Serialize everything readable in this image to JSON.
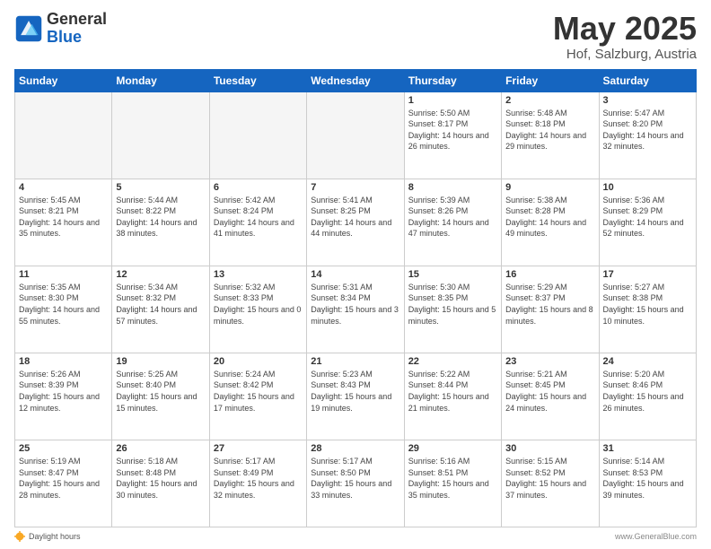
{
  "header": {
    "logo_general": "General",
    "logo_blue": "Blue",
    "title": "May 2025",
    "location": "Hof, Salzburg, Austria"
  },
  "weekdays": [
    "Sunday",
    "Monday",
    "Tuesday",
    "Wednesday",
    "Thursday",
    "Friday",
    "Saturday"
  ],
  "weeks": [
    [
      {
        "day": "",
        "empty": true
      },
      {
        "day": "",
        "empty": true
      },
      {
        "day": "",
        "empty": true
      },
      {
        "day": "",
        "empty": true
      },
      {
        "day": "1",
        "sunrise": "5:50 AM",
        "sunset": "8:17 PM",
        "daylight": "14 hours and 26 minutes."
      },
      {
        "day": "2",
        "sunrise": "5:48 AM",
        "sunset": "8:18 PM",
        "daylight": "14 hours and 29 minutes."
      },
      {
        "day": "3",
        "sunrise": "5:47 AM",
        "sunset": "8:20 PM",
        "daylight": "14 hours and 32 minutes."
      }
    ],
    [
      {
        "day": "4",
        "sunrise": "5:45 AM",
        "sunset": "8:21 PM",
        "daylight": "14 hours and 35 minutes."
      },
      {
        "day": "5",
        "sunrise": "5:44 AM",
        "sunset": "8:22 PM",
        "daylight": "14 hours and 38 minutes."
      },
      {
        "day": "6",
        "sunrise": "5:42 AM",
        "sunset": "8:24 PM",
        "daylight": "14 hours and 41 minutes."
      },
      {
        "day": "7",
        "sunrise": "5:41 AM",
        "sunset": "8:25 PM",
        "daylight": "14 hours and 44 minutes."
      },
      {
        "day": "8",
        "sunrise": "5:39 AM",
        "sunset": "8:26 PM",
        "daylight": "14 hours and 47 minutes."
      },
      {
        "day": "9",
        "sunrise": "5:38 AM",
        "sunset": "8:28 PM",
        "daylight": "14 hours and 49 minutes."
      },
      {
        "day": "10",
        "sunrise": "5:36 AM",
        "sunset": "8:29 PM",
        "daylight": "14 hours and 52 minutes."
      }
    ],
    [
      {
        "day": "11",
        "sunrise": "5:35 AM",
        "sunset": "8:30 PM",
        "daylight": "14 hours and 55 minutes."
      },
      {
        "day": "12",
        "sunrise": "5:34 AM",
        "sunset": "8:32 PM",
        "daylight": "14 hours and 57 minutes."
      },
      {
        "day": "13",
        "sunrise": "5:32 AM",
        "sunset": "8:33 PM",
        "daylight": "15 hours and 0 minutes."
      },
      {
        "day": "14",
        "sunrise": "5:31 AM",
        "sunset": "8:34 PM",
        "daylight": "15 hours and 3 minutes."
      },
      {
        "day": "15",
        "sunrise": "5:30 AM",
        "sunset": "8:35 PM",
        "daylight": "15 hours and 5 minutes."
      },
      {
        "day": "16",
        "sunrise": "5:29 AM",
        "sunset": "8:37 PM",
        "daylight": "15 hours and 8 minutes."
      },
      {
        "day": "17",
        "sunrise": "5:27 AM",
        "sunset": "8:38 PM",
        "daylight": "15 hours and 10 minutes."
      }
    ],
    [
      {
        "day": "18",
        "sunrise": "5:26 AM",
        "sunset": "8:39 PM",
        "daylight": "15 hours and 12 minutes."
      },
      {
        "day": "19",
        "sunrise": "5:25 AM",
        "sunset": "8:40 PM",
        "daylight": "15 hours and 15 minutes."
      },
      {
        "day": "20",
        "sunrise": "5:24 AM",
        "sunset": "8:42 PM",
        "daylight": "15 hours and 17 minutes."
      },
      {
        "day": "21",
        "sunrise": "5:23 AM",
        "sunset": "8:43 PM",
        "daylight": "15 hours and 19 minutes."
      },
      {
        "day": "22",
        "sunrise": "5:22 AM",
        "sunset": "8:44 PM",
        "daylight": "15 hours and 21 minutes."
      },
      {
        "day": "23",
        "sunrise": "5:21 AM",
        "sunset": "8:45 PM",
        "daylight": "15 hours and 24 minutes."
      },
      {
        "day": "24",
        "sunrise": "5:20 AM",
        "sunset": "8:46 PM",
        "daylight": "15 hours and 26 minutes."
      }
    ],
    [
      {
        "day": "25",
        "sunrise": "5:19 AM",
        "sunset": "8:47 PM",
        "daylight": "15 hours and 28 minutes."
      },
      {
        "day": "26",
        "sunrise": "5:18 AM",
        "sunset": "8:48 PM",
        "daylight": "15 hours and 30 minutes."
      },
      {
        "day": "27",
        "sunrise": "5:17 AM",
        "sunset": "8:49 PM",
        "daylight": "15 hours and 32 minutes."
      },
      {
        "day": "28",
        "sunrise": "5:17 AM",
        "sunset": "8:50 PM",
        "daylight": "15 hours and 33 minutes."
      },
      {
        "day": "29",
        "sunrise": "5:16 AM",
        "sunset": "8:51 PM",
        "daylight": "15 hours and 35 minutes."
      },
      {
        "day": "30",
        "sunrise": "5:15 AM",
        "sunset": "8:52 PM",
        "daylight": "15 hours and 37 minutes."
      },
      {
        "day": "31",
        "sunrise": "5:14 AM",
        "sunset": "8:53 PM",
        "daylight": "15 hours and 39 minutes."
      }
    ]
  ],
  "footer": {
    "daylight_label": "Daylight hours",
    "url": "www.GeneralBlue.com"
  }
}
